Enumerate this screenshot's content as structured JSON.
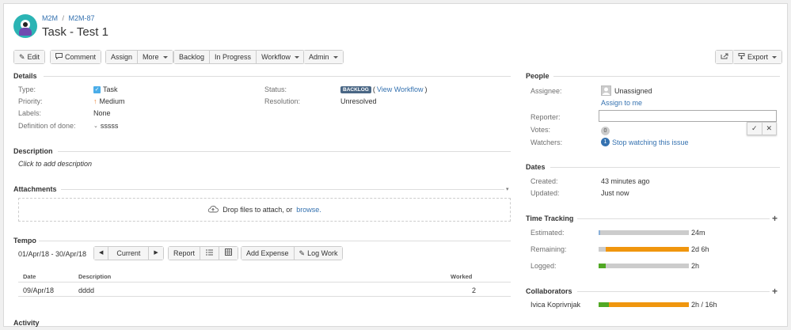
{
  "breadcrumb": {
    "project": "M2M",
    "sep": "/",
    "issue_key": "M2M-87"
  },
  "issue_title": "Task - Test 1",
  "toolbar": {
    "edit": "Edit",
    "comment": "Comment",
    "assign": "Assign",
    "more": "More",
    "backlog": "Backlog",
    "in_progress": "In Progress",
    "workflow": "Workflow",
    "admin": "Admin",
    "export": "Export"
  },
  "details": {
    "title": "Details",
    "type_label": "Type:",
    "type_value": "Task",
    "priority_label": "Priority:",
    "priority_value": "Medium",
    "labels_label": "Labels:",
    "labels_value": "None",
    "dod_label": "Definition of done:",
    "dod_value": "sssss",
    "status_label": "Status:",
    "status_badge": "BACKLOG",
    "status_link": "View Workflow",
    "resolution_label": "Resolution:",
    "resolution_value": "Unresolved"
  },
  "description": {
    "title": "Description",
    "placeholder": "Click to add description"
  },
  "attachments": {
    "title": "Attachments",
    "drop_text": "Drop files to attach, or",
    "browse": "browse."
  },
  "tempo": {
    "title": "Tempo",
    "range": "01/Apr/18 - 30/Apr/18",
    "current": "Current",
    "report": "Report",
    "add_expense": "Add Expense",
    "log_work": "Log Work",
    "columns": [
      "Date",
      "Description",
      "Worked"
    ],
    "rows": [
      {
        "date": "09/Apr/18",
        "description": "dddd",
        "worked": "2"
      }
    ]
  },
  "activity": {
    "title": "Activity"
  },
  "people": {
    "title": "People",
    "assignee_label": "Assignee:",
    "assignee_value": "Unassigned",
    "assign_to_me": "Assign to me",
    "reporter_label": "Reporter:",
    "votes_label": "Votes:",
    "votes_count": "0",
    "watchers_label": "Watchers:",
    "watchers_count": "1",
    "watchers_link": "Stop watching this issue"
  },
  "dates": {
    "title": "Dates",
    "created_label": "Created:",
    "created_value": "43 minutes ago",
    "updated_label": "Updated:",
    "updated_value": "Just now"
  },
  "time_tracking": {
    "title": "Time Tracking",
    "estimated_label": "Estimated:",
    "estimated_value": "24m",
    "estimated_fraction": 0.02,
    "remaining_label": "Remaining:",
    "remaining_value": "2d 6h",
    "remaining_fraction": 0.92,
    "logged_label": "Logged:",
    "logged_value": "2h",
    "logged_fraction": 0.08
  },
  "collaborators": {
    "title": "Collaborators",
    "rows": [
      {
        "name": "Ivica Koprivnjak",
        "value": "2h / 16h",
        "logged_fraction": 0.11
      }
    ]
  },
  "colors": {
    "link": "#3572b0",
    "backlog_badge": "#4a6785",
    "remaining_bar": "#f0960e",
    "logged_bar": "#51a825",
    "track_bar": "#cccccc",
    "estimated_bar": "#89afd7"
  }
}
